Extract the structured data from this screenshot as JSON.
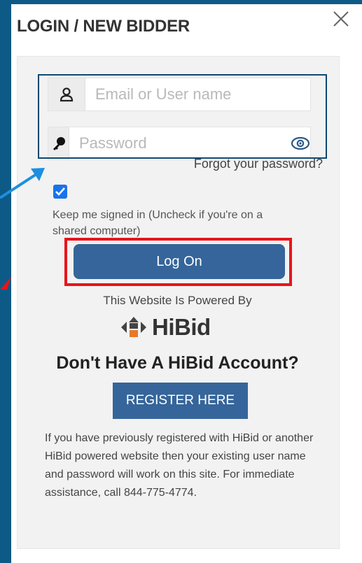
{
  "modal": {
    "title": "LOGIN / NEW BIDDER"
  },
  "login_form": {
    "username_placeholder": "Email or User name",
    "username_value": "",
    "password_placeholder": "Password",
    "password_value": "",
    "forgot_label": "Forgot your password?",
    "keep_signed_in_checked": true,
    "keep_signed_in_label": "Keep me signed in (Uncheck if you're on a shared computer)",
    "logon_label": "Log On"
  },
  "powered_by": {
    "text": "This Website Is Powered By",
    "brand": "HiBid"
  },
  "register": {
    "heading": "Don't Have A HiBid Account?",
    "button_label": "REGISTER HERE",
    "info": "If you have previously registered with HiBid or another HiBid powered website then your existing user name and password will work on this site. For immediate assistance, call 844-775-4774."
  },
  "annotations": {
    "arrow_color": "#1d8fe0",
    "highlight_blue_color": "#0e4870",
    "highlight_red_color": "#e8141b"
  },
  "colors": {
    "background": "#0e5a86",
    "button": "#35659a",
    "checkbox": "#1a73e8"
  },
  "icons": {
    "close": "close-icon",
    "user": "user-icon",
    "key": "key-icon",
    "eye": "eye-icon",
    "check": "check-icon",
    "logo": "hibid-logo-icon"
  }
}
